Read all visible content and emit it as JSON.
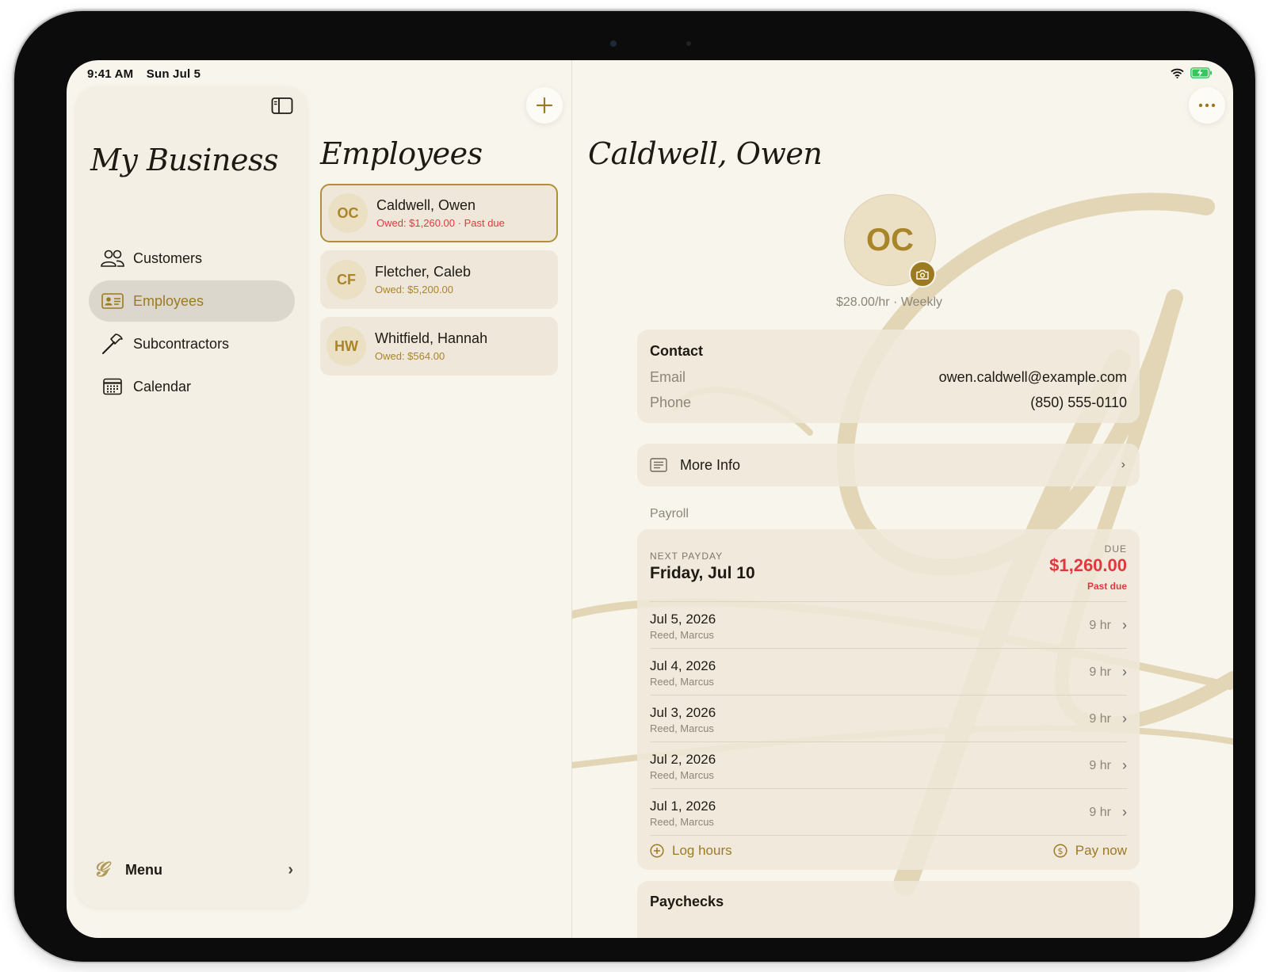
{
  "status": {
    "time": "9:41 AM",
    "date": "Sun Jul 5"
  },
  "sidebar": {
    "title": "My Business",
    "items": [
      {
        "label": "Customers",
        "icon": "people-icon"
      },
      {
        "label": "Employees",
        "icon": "id-card-icon",
        "active": true
      },
      {
        "label": "Subcontractors",
        "icon": "hammer-icon"
      },
      {
        "label": "Calendar",
        "icon": "calendar-icon"
      }
    ],
    "menu_label": "Menu"
  },
  "employees": {
    "title": "Employees",
    "list": [
      {
        "initials": "OC",
        "name": "Caldwell, Owen",
        "owed": "Owed: $1,260.00 · Past due",
        "selected": true
      },
      {
        "initials": "CF",
        "name": "Fletcher, Caleb",
        "owed": "Owed: $5,200.00"
      },
      {
        "initials": "HW",
        "name": "Whitfield, Hannah",
        "owed": "Owed: $564.00"
      }
    ]
  },
  "detail": {
    "title": "Caldwell, Owen",
    "initials": "OC",
    "rate": "$28.00/hr · Weekly",
    "contact": {
      "title": "Contact",
      "email_label": "Email",
      "email": "owen.caldwell@example.com",
      "phone_label": "Phone",
      "phone": "(850) 555-0110"
    },
    "more_info": "More Info",
    "payroll": {
      "section": "Payroll",
      "next_payday_label": "NEXT PAYDAY",
      "next_payday": "Friday, Jul 10",
      "due_label": "DUE",
      "due_amount": "$1,260.00",
      "due_status": "Past due",
      "entries": [
        {
          "date": "Jul 5, 2026",
          "worker": "Reed, Marcus",
          "hours": "9 hr"
        },
        {
          "date": "Jul 4, 2026",
          "worker": "Reed, Marcus",
          "hours": "9 hr"
        },
        {
          "date": "Jul 3, 2026",
          "worker": "Reed, Marcus",
          "hours": "9 hr"
        },
        {
          "date": "Jul 2, 2026",
          "worker": "Reed, Marcus",
          "hours": "9 hr"
        },
        {
          "date": "Jul 1, 2026",
          "worker": "Reed, Marcus",
          "hours": "9 hr"
        }
      ],
      "log_hours": "Log hours",
      "pay_now": "Pay now"
    },
    "paychecks_title": "Paychecks"
  },
  "colors": {
    "accent": "#9c7a22",
    "danger": "#e0383e",
    "background": "#f8f5ec"
  }
}
